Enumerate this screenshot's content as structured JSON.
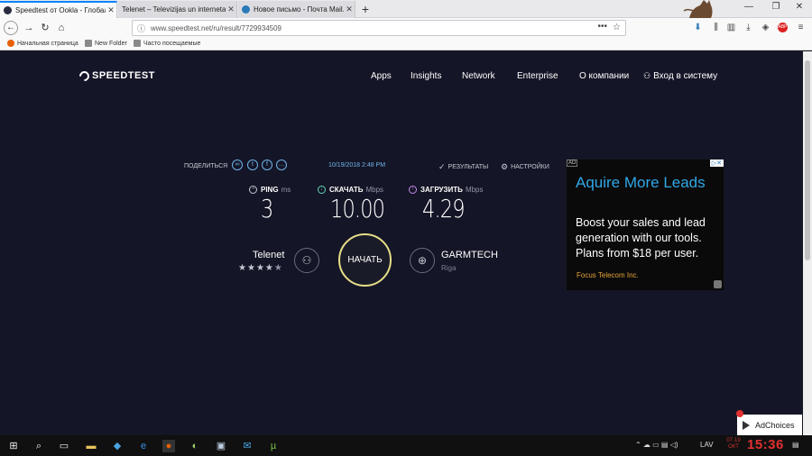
{
  "browser": {
    "tabs": [
      {
        "title": "Speedtest от Ookla - Глобальный",
        "active": true,
        "favicon_color": "#2a2b3f"
      },
      {
        "title": "Telenet – Televizijas un interneta p",
        "active": false,
        "favicon_color": "#f2f2f2"
      },
      {
        "title": "Новое письмо - Почта Mail.Ru",
        "active": false,
        "favicon_color": "#2a7ab8"
      }
    ],
    "new_tab_glyph": "+",
    "url": "www.speedtest.net/ru/result/7729934509",
    "url_dots": "•••",
    "bookmarks": [
      {
        "label": "Начальная страница",
        "icon_color": "#e66000"
      },
      {
        "label": "New Folder",
        "icon_color": "#8a8a8a"
      },
      {
        "label": "Часто посещаемые",
        "icon_color": "#8a8a8a"
      }
    ]
  },
  "site": {
    "logo": "SPEEDTEST",
    "nav": [
      "Apps",
      "Insights",
      "Network",
      "Enterprise",
      "О компании",
      "Вход в систему"
    ]
  },
  "result": {
    "share_label": "ПОДЕЛИТЬСЯ",
    "share_icons": [
      "link-icon",
      "twitter-icon",
      "facebook-icon",
      "more-icon"
    ],
    "datetime": "10/19/2018 2:48 PM",
    "results_label": "РЕЗУЛЬТАТЫ",
    "settings_label": "НАСТРОЙКИ",
    "ping": {
      "label": "PING",
      "unit": "ms",
      "value": "3"
    },
    "download": {
      "label": "СКАЧАТЬ",
      "unit": "Mbps",
      "value": "10.00"
    },
    "upload": {
      "label": "ЗАГРУЗИТЬ",
      "unit": "Mbps",
      "value": "4.29"
    },
    "isp": {
      "name": "Telenet",
      "rating": 4,
      "rating_max": 5
    },
    "go_button": "НАЧАТЬ",
    "server": {
      "name": "GARMTECH",
      "location": "Riga"
    }
  },
  "ad": {
    "tag": "AD",
    "close": "▷✕",
    "headline": "Aquire More Leads",
    "body": "Boost your sales and lead generation with our tools. Plans from $18 per user.",
    "advertiser": "Focus Telecom Inc.",
    "colors": {
      "headline": "#30a7e6",
      "advertiser": "#e8a53a"
    }
  },
  "adchoices": "AdChoices",
  "taskbar": {
    "language": "LAV",
    "clock": "15:36",
    "date_small": "07·19 ОКТ"
  },
  "colors": {
    "page_bg": "#141526",
    "go_ring": "#e6dd88",
    "accent_blue": "#6fb3ea"
  }
}
